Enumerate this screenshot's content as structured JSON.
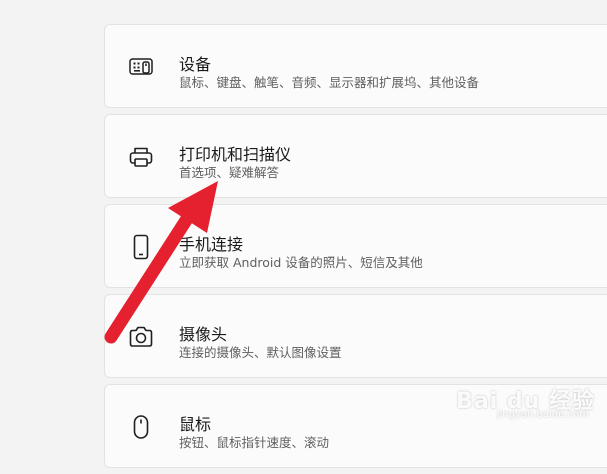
{
  "settings_list": {
    "items": [
      {
        "icon": "keyboard-icon",
        "title": "设备",
        "subtitle": "鼠标、键盘、触笔、音频、显示器和扩展坞、其他设备"
      },
      {
        "icon": "printer-icon",
        "title": "打印机和扫描仪",
        "subtitle": "首选项、疑难解答"
      },
      {
        "icon": "phone-icon",
        "title": "手机连接",
        "subtitle": "立即获取 Android 设备的照片、短信及其他"
      },
      {
        "icon": "camera-icon",
        "title": "摄像头",
        "subtitle": "连接的摄像头、默认图像设置"
      },
      {
        "icon": "mouse-icon",
        "title": "鼠标",
        "subtitle": "按钮、鼠标指针速度、滚动"
      }
    ]
  },
  "annotation": {
    "arrow_color": "#e5202f"
  },
  "watermark": {
    "main": "Bai du 经验",
    "sub": "jingyan.baidu.com"
  }
}
